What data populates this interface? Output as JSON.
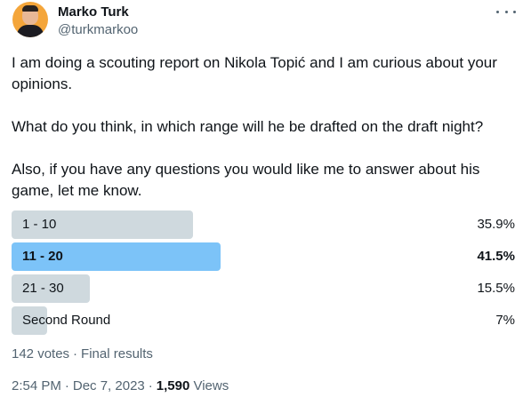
{
  "author": {
    "name": "Marko Turk",
    "handle": "@turkmarkoo"
  },
  "text": {
    "p1": "I am doing a scouting report on Nikola Topić and I am curious about your opinions.",
    "p2": "What do you think, in which range will he be drafted on the draft night?",
    "p3": "Also, if you have any questions you would like me to answer about his game, let me know."
  },
  "poll": {
    "options": [
      {
        "label": "1 - 10",
        "percent_label": "35.9%",
        "percent": 35.9,
        "winner": false
      },
      {
        "label": "11 - 20",
        "percent_label": "41.5%",
        "percent": 41.5,
        "winner": true
      },
      {
        "label": "21 - 30",
        "percent_label": "15.5%",
        "percent": 15.5,
        "winner": false
      },
      {
        "label": "Second Round",
        "percent_label": "7%",
        "percent": 7,
        "winner": false
      }
    ],
    "votes": "142 votes",
    "status": "Final results"
  },
  "timestamp": {
    "time": "2:54 PM",
    "date": "Dec 7, 2023",
    "views_count": "1,590",
    "views_label": "Views"
  },
  "colors": {
    "bar": "#cfd9de",
    "winner_bar": "#7cc3f8",
    "secondary_text": "#536471"
  }
}
